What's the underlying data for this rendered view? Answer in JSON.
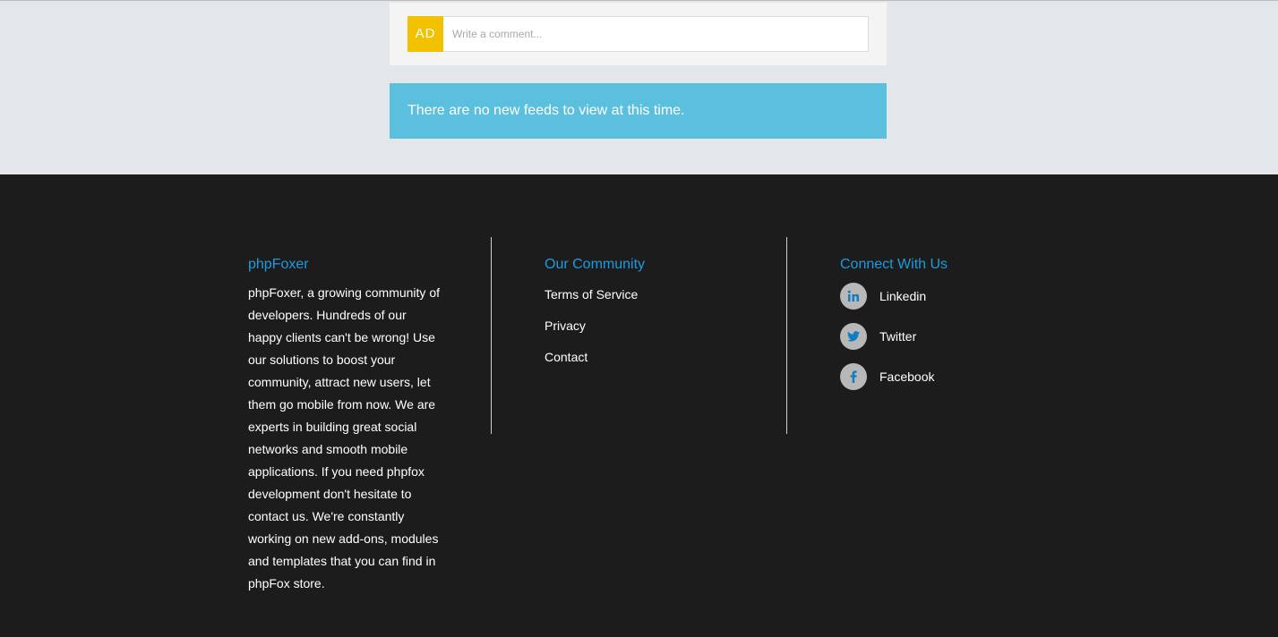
{
  "comment": {
    "avatar_initials": "AD",
    "placeholder": "Write a comment..."
  },
  "notice": {
    "text": "There are no new feeds to view at this time."
  },
  "footer": {
    "about": {
      "title": "phpFoxer",
      "text": "phpFoxer, a growing community of developers. Hundreds of our happy clients can't be wrong! Use our solutions to boost your community, attract new users, let them go mobile from now. We are experts in building great social networks and smooth mobile applications. If you need phpfox development don't hesitate to contact us. We're constantly working on new add-ons, modules and templates that you can find in phpFox store."
    },
    "community": {
      "title": "Our Community",
      "links": [
        "Terms of Service",
        "Privacy",
        "Contact"
      ]
    },
    "connect": {
      "title": "Connect With Us",
      "items": [
        {
          "label": "Linkedin",
          "icon": "linkedin-icon"
        },
        {
          "label": "Twitter",
          "icon": "twitter-icon"
        },
        {
          "label": "Facebook",
          "icon": "facebook-icon"
        }
      ]
    }
  },
  "colors": {
    "avatar": "#f2c200",
    "notice": "#5bc0de",
    "footer_bg": "#1c1c1c",
    "heading": "#1e9be0"
  }
}
